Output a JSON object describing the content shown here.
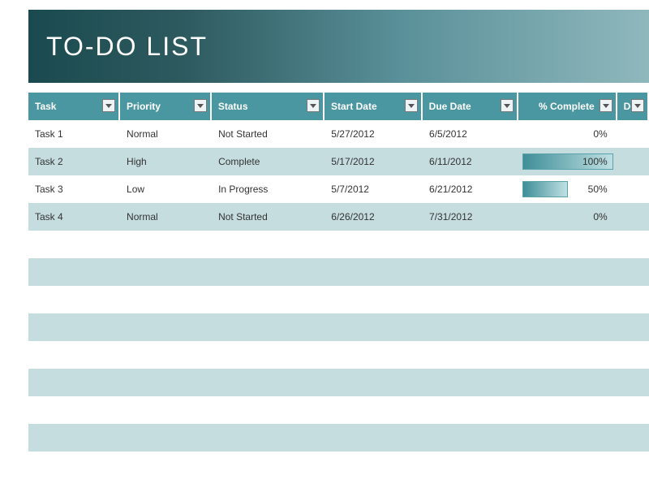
{
  "title": "TO-DO LIST",
  "columns": [
    {
      "label": "Task",
      "align": "left"
    },
    {
      "label": "Priority",
      "align": "left"
    },
    {
      "label": "Status",
      "align": "left"
    },
    {
      "label": "Start Date",
      "align": "left"
    },
    {
      "label": "Due Date",
      "align": "left"
    },
    {
      "label": "% Complete",
      "align": "right"
    },
    {
      "label": "Don",
      "align": "left"
    }
  ],
  "rows": [
    {
      "task": "Task 1",
      "priority": "Normal",
      "status": "Not Started",
      "start": "5/27/2012",
      "due": "6/5/2012",
      "pct": 0,
      "pct_label": "0%"
    },
    {
      "task": "Task 2",
      "priority": "High",
      "status": "Complete",
      "start": "5/17/2012",
      "due": "6/11/2012",
      "pct": 100,
      "pct_label": "100%"
    },
    {
      "task": "Task 3",
      "priority": "Low",
      "status": "In Progress",
      "start": "5/7/2012",
      "due": "6/21/2012",
      "pct": 50,
      "pct_label": "50%"
    },
    {
      "task": "Task 4",
      "priority": "Normal",
      "status": "Not Started",
      "start": "6/26/2012",
      "due": "7/31/2012",
      "pct": 0,
      "pct_label": "0%"
    }
  ],
  "empty_rows": 9
}
